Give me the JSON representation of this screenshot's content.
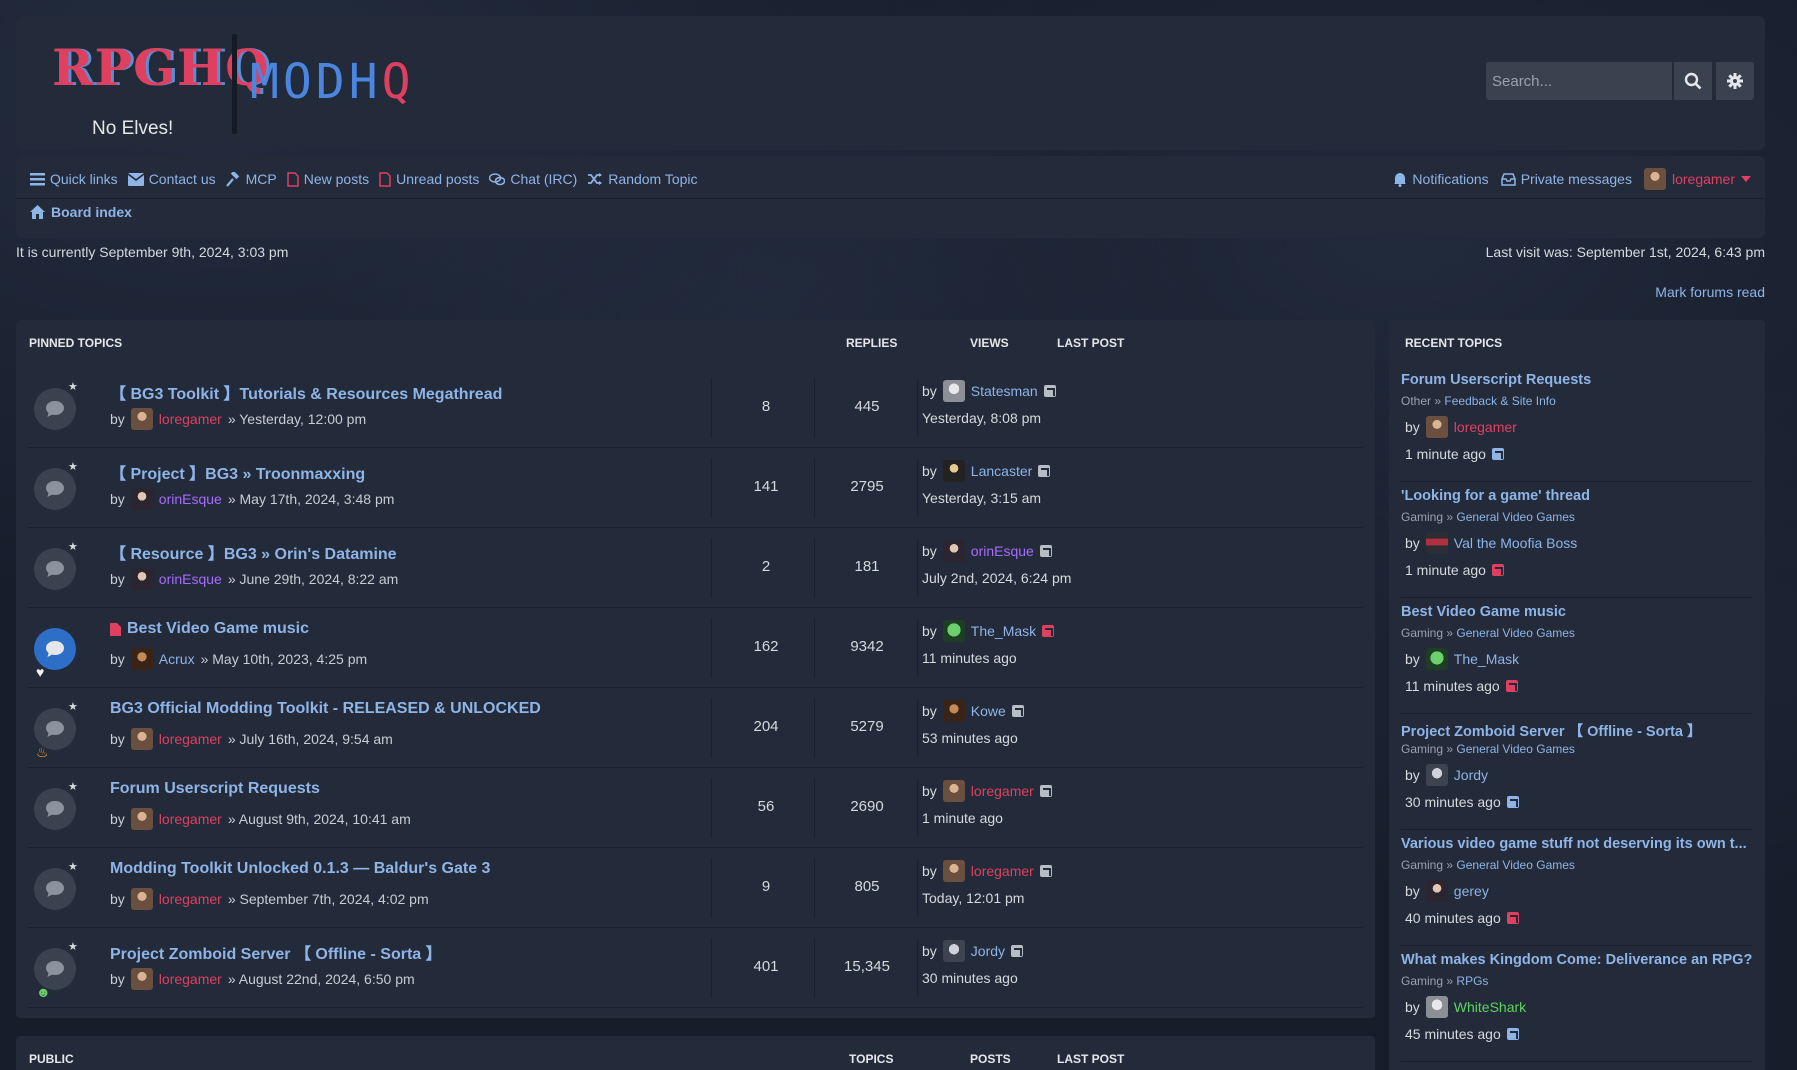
{
  "header": {
    "logo_rpghq": "RPGHQ",
    "logo_modhq": "MODHQ",
    "tagline": "No Elves!",
    "search_placeholder": "Search...",
    "search_icon": "search-icon",
    "advanced_search_icon": "gear-icon"
  },
  "nav": {
    "left": [
      {
        "label": "Quick links",
        "icon": "hamburger-icon"
      },
      {
        "label": "Contact us",
        "icon": "envelope-icon"
      },
      {
        "label": "MCP",
        "icon": "gavel-icon"
      },
      {
        "label": "New posts",
        "icon": "file-icon"
      },
      {
        "label": "Unread posts",
        "icon": "file-icon"
      },
      {
        "label": "Chat (IRC)",
        "icon": "chat-icon"
      },
      {
        "label": "Random Topic",
        "icon": "shuffle-icon"
      }
    ],
    "notifications": "Notifications",
    "private_messages": "Private messages",
    "username": "loregamer",
    "breadcrumb": "Board index"
  },
  "status": {
    "current_time": "It is currently September 9th, 2024, 3:03 pm",
    "last_visit": "Last visit was: September 1st, 2024, 6:43 pm",
    "mark_read": "Mark forums read"
  },
  "pinned": {
    "heading": "PINNED TOPICS",
    "col_replies": "REPLIES",
    "col_views": "VIEWS",
    "col_last_post": "LAST POST",
    "topics": [
      {
        "title": "【 BG3 Toolkit 】Tutorials & Resources Megathread",
        "by": "by",
        "author": "loregamer",
        "date": "» Yesterday, 12:00 pm",
        "replies": "8",
        "views": "445",
        "last_by": "by",
        "last_user": "Statesman",
        "last_time": "Yesterday, 8:08 pm"
      },
      {
        "title": "【 Project 】BG3 » Troonmaxxing",
        "by": "by",
        "author": "orinEsque",
        "date": "» May 17th, 2024, 3:48 pm",
        "replies": "141",
        "views": "2795",
        "last_by": "by",
        "last_user": "Lancaster",
        "last_time": "Yesterday, 3:15 am"
      },
      {
        "title": "【 Resource 】BG3 » Orin's Datamine",
        "by": "by",
        "author": "orinEsque",
        "date": "» June 29th, 2024, 8:22 am",
        "replies": "2",
        "views": "181",
        "last_by": "by",
        "last_user": "orinEsque",
        "last_time": "July 2nd, 2024, 6:24 pm"
      },
      {
        "title": "Best Video Game music",
        "by": "by",
        "author": "Acrux",
        "date": "» May 10th, 2023, 4:25 pm",
        "replies": "162",
        "views": "9342",
        "last_by": "by",
        "last_user": "The_Mask",
        "last_time": "11 minutes ago"
      },
      {
        "title": "BG3 Official Modding Toolkit - RELEASED & UNLOCKED",
        "by": "by",
        "author": "loregamer",
        "date": "» July 16th, 2024, 9:54 am",
        "replies": "204",
        "views": "5279",
        "last_by": "by",
        "last_user": "Kowe",
        "last_time": "53 minutes ago"
      },
      {
        "title": "Forum Userscript Requests",
        "by": "by",
        "author": "loregamer",
        "date": "» August 9th, 2024, 10:41 am",
        "replies": "56",
        "views": "2690",
        "last_by": "by",
        "last_user": "loregamer",
        "last_time": "1 minute ago"
      },
      {
        "title": "Modding Toolkit Unlocked 0.1.3 — Baldur's Gate 3",
        "by": "by",
        "author": "loregamer",
        "date": "» September 7th, 2024, 4:02 pm",
        "replies": "9",
        "views": "805",
        "last_by": "by",
        "last_user": "loregamer",
        "last_time": "Today, 12:01 pm"
      },
      {
        "title": "Project Zomboid Server 【 Offline - Sorta 】",
        "by": "by",
        "author": "loregamer",
        "date": "» August 22nd, 2024, 6:50 pm",
        "replies": "401",
        "views": "15,345",
        "last_by": "by",
        "last_user": "Jordy",
        "last_time": "30 minutes ago"
      }
    ]
  },
  "recent": {
    "heading": "RECENT TOPICS",
    "items": [
      {
        "title": "Forum Userscript Requests",
        "cat1": "Other",
        "sep": "»",
        "cat2": "Feedback & Site Info",
        "by": "by",
        "user": "loregamer",
        "time": "1 minute ago"
      },
      {
        "title": "'Looking for a game' thread",
        "cat1": "Gaming",
        "sep": "»",
        "cat2": "General Video Games",
        "by": "by",
        "user": "Val the Moofia Boss",
        "time": "1 minute ago"
      },
      {
        "title": "Best Video Game music",
        "cat1": "Gaming",
        "sep": "»",
        "cat2": "General Video Games",
        "by": "by",
        "user": "The_Mask",
        "time": "11 minutes ago"
      },
      {
        "title": "Project Zomboid Server 【 Offline - Sorta 】",
        "cat1": "Gaming",
        "sep": "»",
        "cat2": "General Video Games",
        "by": "by",
        "user": "Jordy",
        "time": "30 minutes ago"
      },
      {
        "title": "Various video game stuff not deserving its own t...",
        "cat1": "Gaming",
        "sep": "»",
        "cat2": "General Video Games",
        "by": "by",
        "user": "gerey",
        "time": "40 minutes ago"
      },
      {
        "title": "What makes Kingdom Come: Deliverance an RPG?",
        "cat1": "Gaming",
        "sep": "»",
        "cat2": "RPGs",
        "by": "by",
        "user": "WhiteShark",
        "time": "45 minutes ago"
      }
    ]
  },
  "public": {
    "heading": "PUBLIC",
    "col_topics": "TOPICS",
    "col_posts": "POSTS",
    "col_last_post": "LAST POST"
  },
  "colors": {
    "accent_blue": "#8fb4e6",
    "user_red": "#e04060",
    "user_purple": "#a86bff",
    "user_green": "#5ed45e",
    "panel_bg": "#232a39"
  }
}
